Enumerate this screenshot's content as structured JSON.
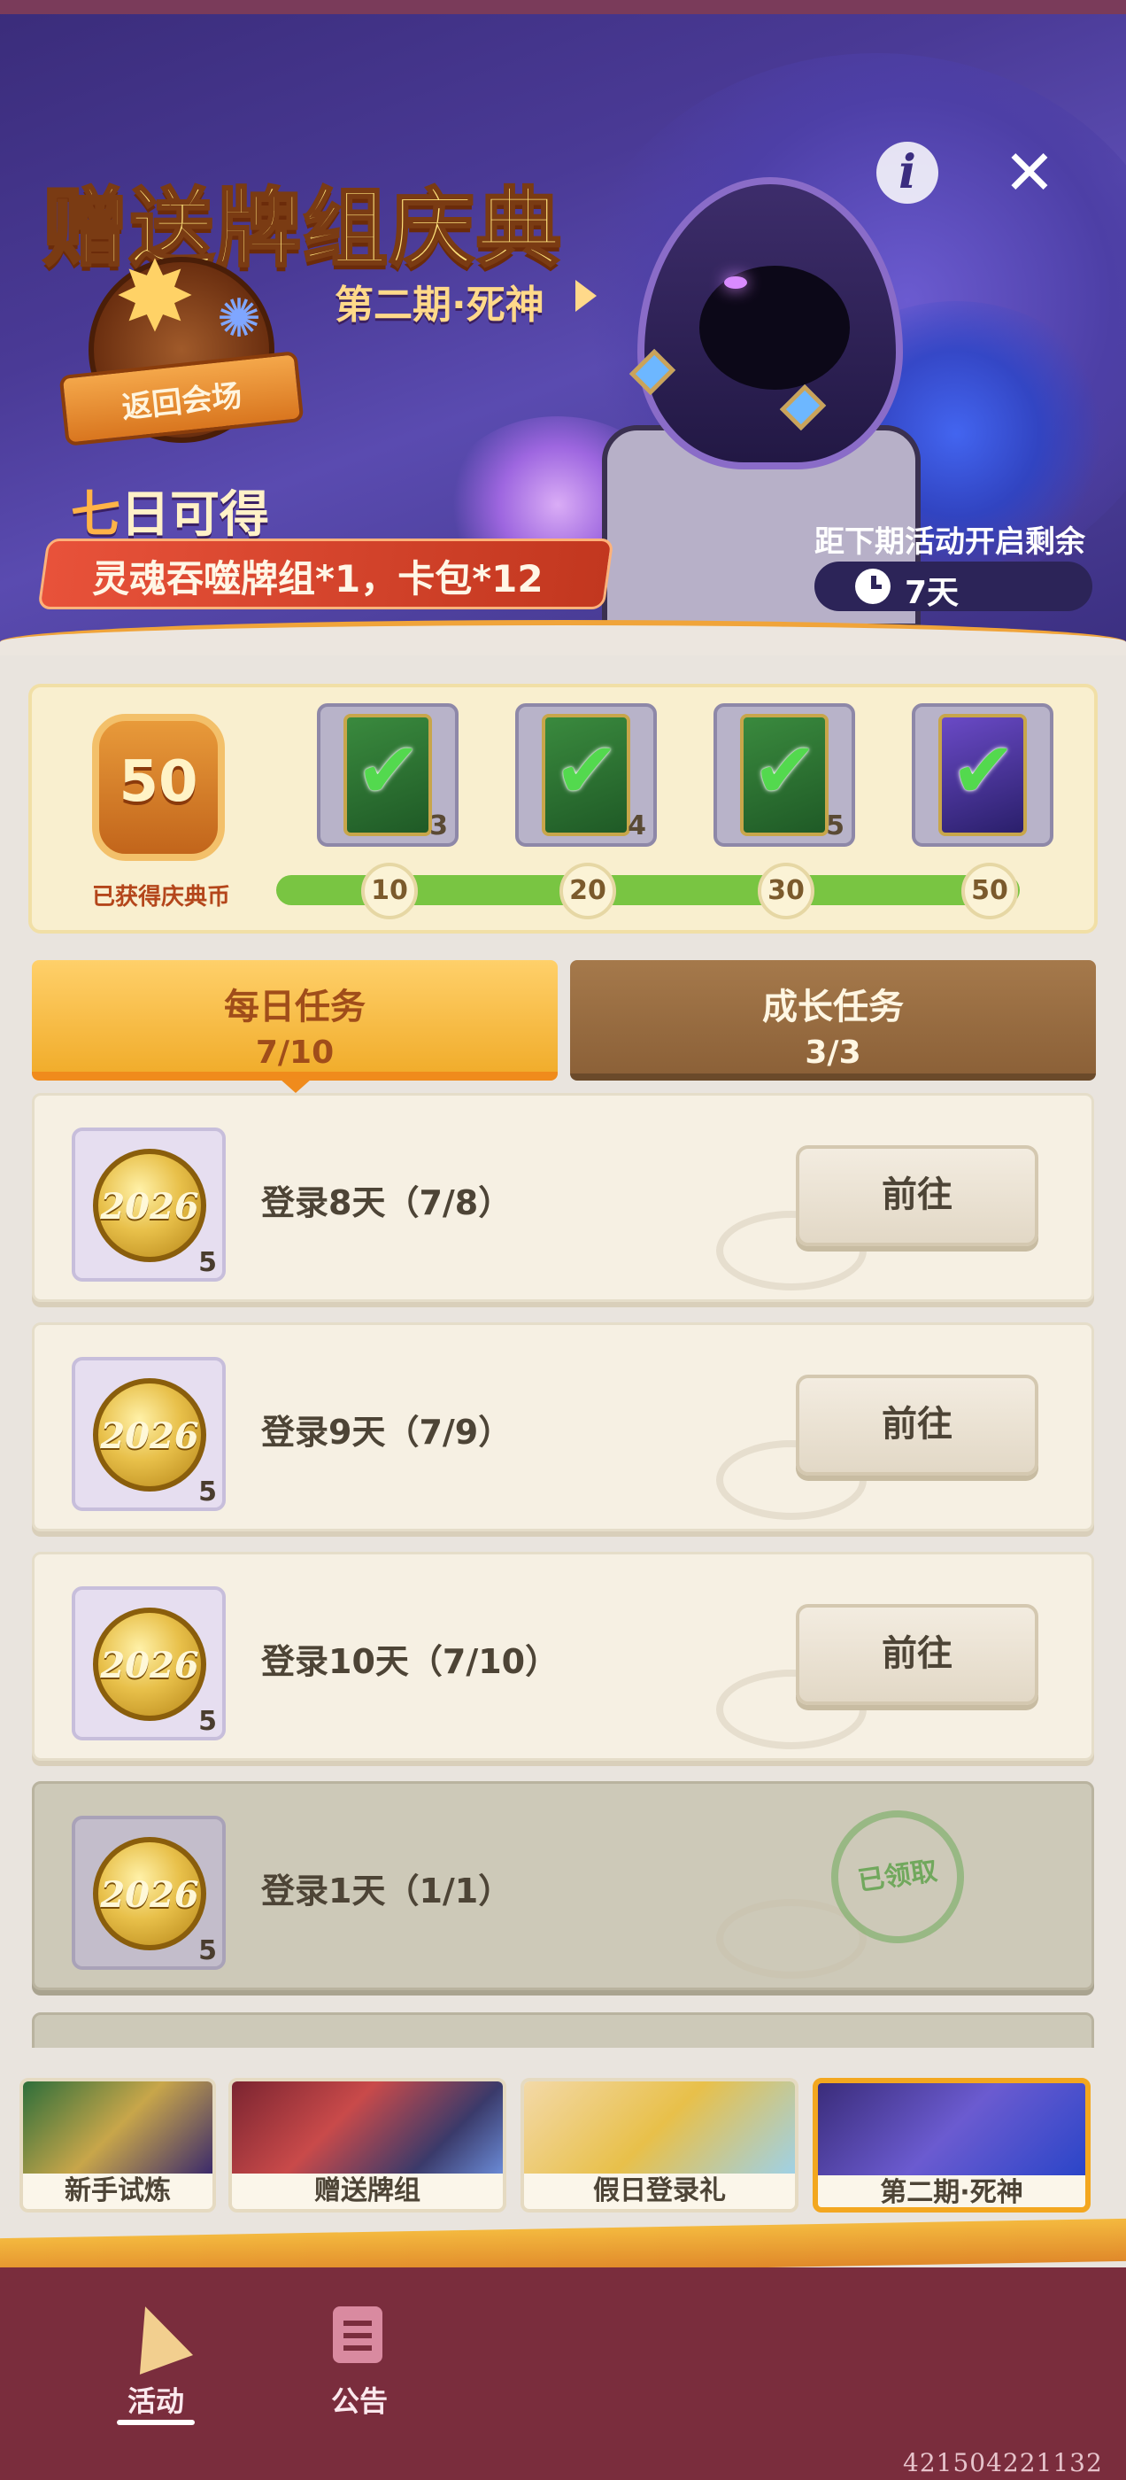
{
  "banner": {
    "title": "赠送牌组庆典",
    "period_link": "第二期·死神",
    "return_venue": "返回会场",
    "seven_days_highlight": "七",
    "seven_days_rest": "日可得",
    "reward_text": "灵魂吞噬牌组*1，卡包*12",
    "countdown_label": "距下期活动开启剩余",
    "countdown_value": "7天",
    "info_icon": "i",
    "close_icon": "✕"
  },
  "progress": {
    "coins_value": "50",
    "coins_label": "已获得庆典币",
    "milestones": [
      {
        "label": "10",
        "reward_count": "3"
      },
      {
        "label": "20",
        "reward_count": "4"
      },
      {
        "label": "30",
        "reward_count": "5"
      },
      {
        "label": "50",
        "reward_count": ""
      }
    ],
    "fill_fraction": 1.0
  },
  "tabs": [
    {
      "label": "每日任务",
      "count": "7/10",
      "selected": true
    },
    {
      "label": "成长任务",
      "count": "3/3",
      "selected": false
    }
  ],
  "tasks": [
    {
      "coin_text": "2026",
      "qty": "5",
      "label": "登录8天（7/8）",
      "action": "前往",
      "claimed": false
    },
    {
      "coin_text": "2026",
      "qty": "5",
      "label": "登录9天（7/9）",
      "action": "前往",
      "claimed": false
    },
    {
      "coin_text": "2026",
      "qty": "5",
      "label": "登录10天（7/10）",
      "action": "前往",
      "claimed": false
    },
    {
      "coin_text": "2026",
      "qty": "5",
      "label": "登录1天（1/1）",
      "action": "已领取",
      "claimed": true
    }
  ],
  "activities": [
    {
      "name": "新手试炼"
    },
    {
      "name": "赠送牌组"
    },
    {
      "name": "假日登录礼"
    },
    {
      "name": "第二期·死神",
      "active": true
    }
  ],
  "bottom_nav": [
    {
      "label": "活动",
      "active": true
    },
    {
      "label": "公告",
      "active": false
    }
  ],
  "build_id": "421504221132",
  "colors": {
    "banner_bg": "#4a3a96",
    "progress_fill": "#79c542",
    "tab_daily": "#f1ad2c",
    "tab_growth": "#8c6138",
    "bottom_nav_bg": "#7a2d3d",
    "active_card_border": "#f3a71f"
  }
}
